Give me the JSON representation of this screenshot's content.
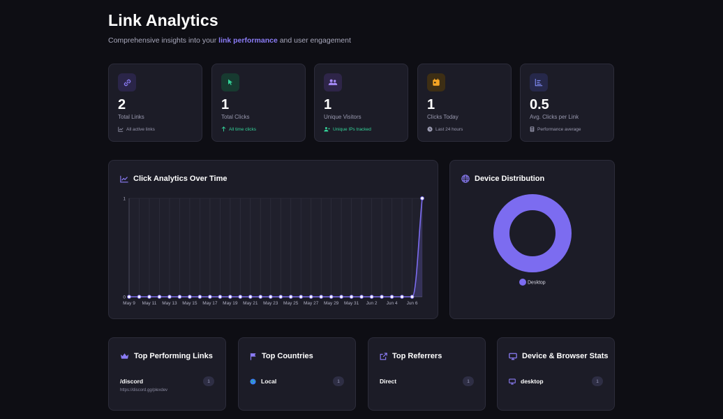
{
  "header": {
    "title": "Link Analytics",
    "subtitle_pre": "Comprehensive insights into your ",
    "subtitle_highlight": "link performance",
    "subtitle_post": " and user engagement"
  },
  "stats": [
    {
      "icon": "link-icon",
      "value": "2",
      "label": "Total Links",
      "sub": "All active links",
      "sub_icon": "line-chart-icon",
      "accent": "#8b7cf6"
    },
    {
      "icon": "cursor-icon",
      "value": "1",
      "label": "Total Clicks",
      "sub": "All time clicks",
      "sub_icon": "arrow-up-icon",
      "accent": "#34d399"
    },
    {
      "icon": "users-icon",
      "value": "1",
      "label": "Unique Visitors",
      "sub": "Unique IPs tracked",
      "sub_icon": "user-plus-icon",
      "accent": "#a78bfa"
    },
    {
      "icon": "calendar-icon",
      "value": "1",
      "label": "Clicks Today",
      "sub": "Last 24 hours",
      "sub_icon": "clock-icon",
      "accent": "#f5a524"
    },
    {
      "icon": "bar-chart-icon",
      "value": "0.5",
      "label": "Avg. Clicks per Link",
      "sub": "Performance average",
      "sub_icon": "calculator-icon",
      "accent": "#818cf8"
    }
  ],
  "click_chart": {
    "title": "Click Analytics Over Time",
    "chart_data": {
      "type": "line",
      "x": [
        "May 9",
        "May 10",
        "May 11",
        "May 12",
        "May 13",
        "May 14",
        "May 15",
        "May 16",
        "May 17",
        "May 18",
        "May 19",
        "May 20",
        "May 21",
        "May 22",
        "May 23",
        "May 24",
        "May 25",
        "May 26",
        "May 27",
        "May 28",
        "May 29",
        "May 30",
        "May 31",
        "Jun 1",
        "Jun 2",
        "Jun 3",
        "Jun 4",
        "Jun 5",
        "Jun 6",
        "Jun 7"
      ],
      "x_tick_labels": [
        "May 9",
        "May 11",
        "May 13",
        "May 15",
        "May 17",
        "May 19",
        "May 21",
        "May 23",
        "May 25",
        "May 27",
        "May 29",
        "May 31",
        "Jun 2",
        "Jun 4",
        "Jun 6"
      ],
      "values": [
        0,
        0,
        0,
        0,
        0,
        0,
        0,
        0,
        0,
        0,
        0,
        0,
        0,
        0,
        0,
        0,
        0,
        0,
        0,
        0,
        0,
        0,
        0,
        0,
        0,
        0,
        0,
        0,
        0,
        1
      ],
      "ylim": [
        0,
        1
      ],
      "y_ticks": [
        "0",
        "1"
      ],
      "grid": true,
      "color": "#7c6cf0"
    }
  },
  "device_chart": {
    "title": "Device Distribution",
    "chart_data": {
      "type": "pie",
      "categories": [
        "Desktop"
      ],
      "values": [
        1
      ],
      "colors": [
        "#7c6cf0"
      ],
      "legend": "bottom"
    }
  },
  "top_links": {
    "title": "Top Performing Links",
    "item": "/discord",
    "item_sub": "https://discord.gg/plexdev",
    "count": "1"
  },
  "top_countries": {
    "title": "Top Countries",
    "item": "Local",
    "count": "1"
  },
  "top_referrers": {
    "title": "Top Referrers",
    "item": "Direct",
    "count": "1"
  },
  "device_stats": {
    "title": "Device & Browser Stats",
    "item": "desktop",
    "count": "1"
  }
}
